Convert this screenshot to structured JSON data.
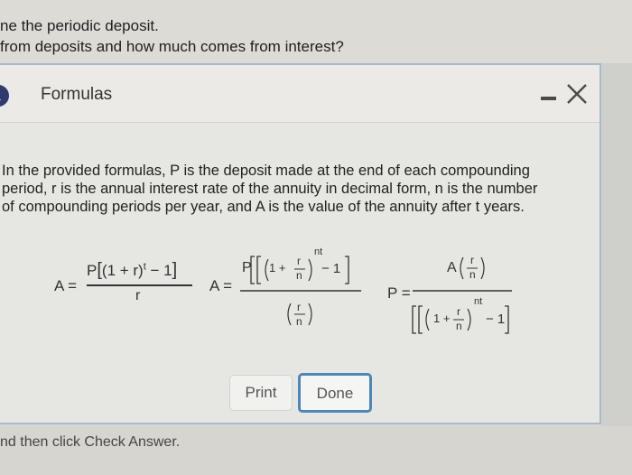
{
  "background": {
    "line1": "ne the periodic deposit.",
    "line2": "from deposits and how much comes from interest?",
    "footer": "nd then click Check Answer."
  },
  "dialog": {
    "title": "Formulas",
    "info_glyph": "i",
    "body_lines": [
      "In the provided formulas, P is the deposit made at the end of each compounding",
      "period, r is the annual interest rate of the annuity in decimal form, n is the number",
      "of compounding periods per year, and A is the value of the annuity after t years."
    ],
    "formulas": {
      "f1": {
        "lhs": "A =",
        "num_p": "P",
        "num_inner": "(1 + r)",
        "num_exp": "t",
        "num_minus": "− 1",
        "den": "r"
      },
      "f2": {
        "lhs": "A =",
        "p": "P",
        "one_plus": "1 +",
        "r": "r",
        "n": "n",
        "exp": "nt",
        "minus": "− 1"
      },
      "f3": {
        "lhs": "P =",
        "a": "A",
        "r": "r",
        "n": "n",
        "one_plus": "1 +",
        "exp": "nt",
        "minus": "− 1"
      }
    },
    "buttons": {
      "print": "Print",
      "done": "Done"
    }
  },
  "colors": {
    "accent": "#4d86b8",
    "info_icon": "#2f3a73"
  },
  "icons": {
    "info": "info-icon",
    "minimize": "minimize-icon",
    "close": "close-icon"
  }
}
